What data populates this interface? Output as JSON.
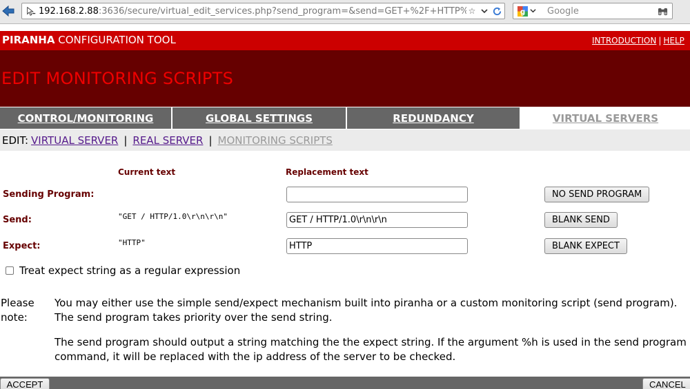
{
  "browser": {
    "url_host": "192.168.2.88",
    "url_rest": ":3636/secure/virtual_edit_services.php?send_program=&send=GET+%2F+HTTP%",
    "search_placeholder": "Google",
    "icons": [
      "back-arrow-icon",
      "site-identity-icon",
      "bookmark-star-icon",
      "dropdown-icon",
      "reload-icon",
      "google-icon",
      "search-dropdown-icon",
      "binoculars-icon"
    ]
  },
  "header": {
    "title_bold": "PIRANHA",
    "title_rest": " CONFIGURATION TOOL",
    "links": [
      "INTRODUCTION",
      "HELP"
    ],
    "link_separator": "|",
    "page_title": "EDIT MONITORING SCRIPTS",
    "colors": {
      "header_red": "#cc0000",
      "banner_maroon": "#660000",
      "title_red": "#ee0000"
    }
  },
  "tabs": [
    {
      "label": "CONTROL/MONITORING",
      "active": false
    },
    {
      "label": "GLOBAL SETTINGS",
      "active": false
    },
    {
      "label": "REDUNDANCY",
      "active": false
    },
    {
      "label": "VIRTUAL SERVERS",
      "active": true
    }
  ],
  "subnav": {
    "prefix": "EDIT:",
    "items": [
      "VIRTUAL SERVER",
      "REAL SERVER",
      "MONITORING SCRIPTS"
    ],
    "separator": "|"
  },
  "form": {
    "col_current": "Current text",
    "col_replacement": "Replacement text",
    "rows": [
      {
        "label": "Sending Program:",
        "current": "",
        "value": "",
        "button": "NO SEND PROGRAM"
      },
      {
        "label": "Send:",
        "current": "\"GET / HTTP/1.0\\r\\n\\r\\n\"",
        "value": "GET / HTTP/1.0\\r\\n\\r\\n",
        "button": "BLANK SEND"
      },
      {
        "label": "Expect:",
        "current": "\"HTTP\"",
        "value": "HTTP",
        "button": "BLANK EXPECT"
      }
    ],
    "regex_label": "Treat expect string as a regular expression",
    "regex_checked": false
  },
  "note": {
    "label": "Please note:",
    "paragraphs": [
      "You may either use the simple send/expect mechanism built into piranha or a custom monitoring script (send program). The send program takes priority over the send string.",
      "The send program should output a string matching the the expect string. If the argument %h is used in the send program command, it will be replaced with the ip address of the server to be checked."
    ]
  },
  "footer": {
    "accept": "ACCEPT",
    "cancel": "CANCEL"
  }
}
